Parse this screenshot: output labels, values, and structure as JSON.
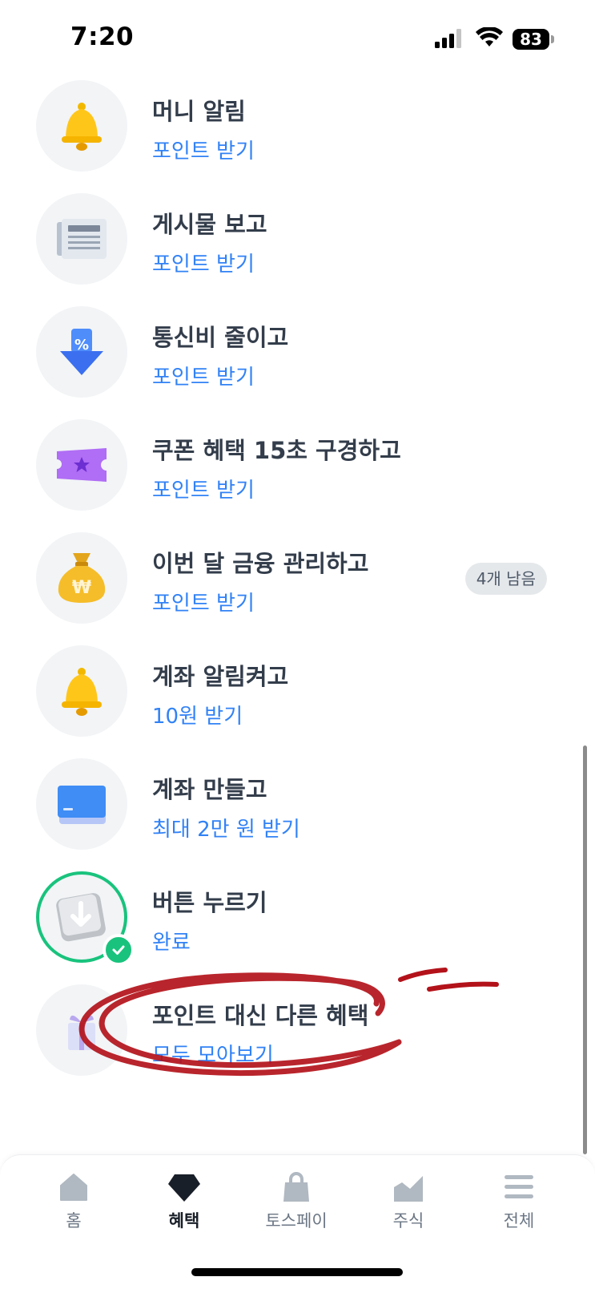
{
  "status_bar": {
    "time": "7:20",
    "battery": "83"
  },
  "items": [
    {
      "title": "머니 알림",
      "subtitle": "포인트 받기",
      "icon": "bell-icon"
    },
    {
      "title": "게시물 보고",
      "subtitle": "포인트 받기",
      "icon": "newspaper-icon"
    },
    {
      "title": "통신비 줄이고",
      "subtitle": "포인트 받기",
      "icon": "discount-arrow-icon"
    },
    {
      "title": "쿠폰 혜택 15초 구경하고",
      "subtitle": "포인트 받기",
      "icon": "coupon-ticket-icon"
    },
    {
      "title": "이번 달 금융 관리하고",
      "subtitle": "포인트 받기",
      "icon": "money-bag-icon",
      "badge": "4개 남음"
    },
    {
      "title": "계좌 알림켜고",
      "subtitle": "10원 받기",
      "icon": "bell-icon"
    },
    {
      "title": "계좌 만들고",
      "subtitle": "최대 2만 원 받기",
      "icon": "card-icon"
    },
    {
      "title": "버튼 누르기",
      "subtitle": "완료",
      "icon": "key-button-icon",
      "completed": true
    },
    {
      "title": "포인트 대신 다른 혜택",
      "subtitle": "모두 모아보기",
      "icon": "gift-icon"
    }
  ],
  "tabs": [
    {
      "label": "홈",
      "icon": "home-icon"
    },
    {
      "label": "혜택",
      "icon": "benefit-gem-icon",
      "active": true
    },
    {
      "label": "토스페이",
      "icon": "shopping-bag-icon"
    },
    {
      "label": "주식",
      "icon": "stock-chart-icon"
    },
    {
      "label": "전체",
      "icon": "menu-icon"
    }
  ],
  "colors": {
    "accent": "#3182f6",
    "done": "#19c37d",
    "annotation": "#b3121a",
    "title": "#333d4b"
  }
}
